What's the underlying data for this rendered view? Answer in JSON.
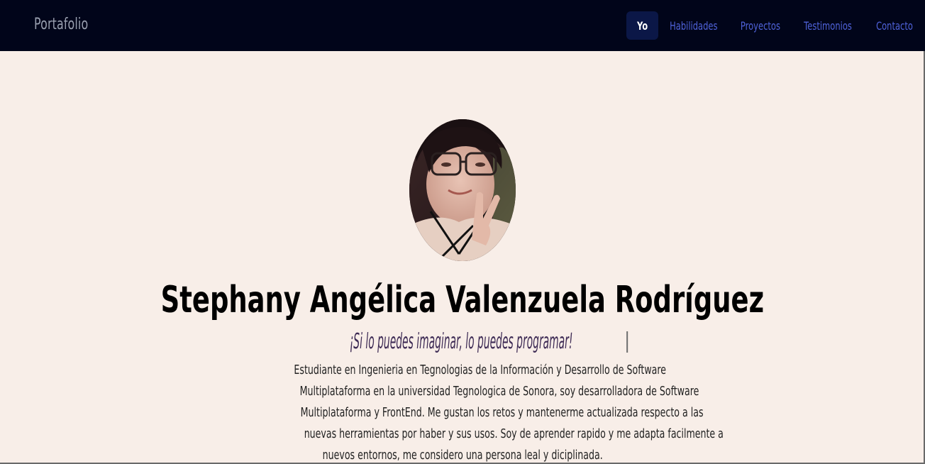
{
  "navbar": {
    "brand": "Portafolio",
    "items": [
      {
        "label": "Yo",
        "active": true
      },
      {
        "label": "Habilidades",
        "active": false
      },
      {
        "label": "Proyectos",
        "active": false
      },
      {
        "label": "Testimonios",
        "active": false
      },
      {
        "label": "Contacto",
        "active": false
      }
    ]
  },
  "hero": {
    "photo_alt": "profile-photo",
    "name": "Stephany Angélica Valenzuela Rodríguez",
    "tagline": "¡Si lo puedes imaginar, lo puedes programar!",
    "bio_lines": [
      "Estudiante en Ingenieria en Tegnologias de la Información y Desarrollo de Software",
      "Multiplataforma en la universidad Tegnologica de Sonora, soy desarrolladora de Software",
      "Multiplataforma y FrontEnd. Me gustan los retos y mantenerme actualizada respecto a las",
      "nuevas herramientas por haber y sus usos. Soy de aprender rapido y me adapta facilmente a",
      "nuevos entornos, me considero una persona leal y diciplinada."
    ]
  },
  "colors": {
    "navbar_bg": "#01051a",
    "page_bg": "#f8eee8",
    "nav_link": "#4f62d9",
    "nav_active_bg": "#0b1747",
    "tagline": "#3d2a54"
  }
}
